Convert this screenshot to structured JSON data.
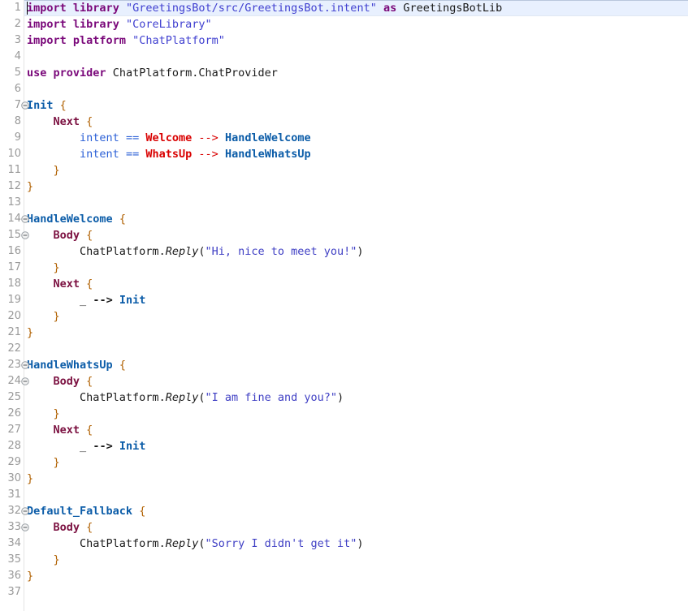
{
  "editor": {
    "name": "code-editor",
    "language": "intent-dsl",
    "total_lines": 37,
    "current_line": 1,
    "caret_line": 1,
    "caret_column": 1,
    "colors": {
      "background": "#ffffff",
      "current_line_highlight": "#e8f0fe",
      "gutter_text": "#999999",
      "keyword": "#7a087a",
      "block_keyword": "#7b1040",
      "state_name": "#0b5ca8",
      "string": "#3f3fc4",
      "constant": "#d90000",
      "brace": "#b06000",
      "operator": "#2a5fd6",
      "default_text": "#1a1a1a"
    }
  },
  "gutter": {
    "fold_marker_icon": "fold-collapse-icon",
    "fold_lines": [
      7,
      14,
      15,
      23,
      24,
      32,
      33
    ],
    "line_numbers": [
      1,
      2,
      3,
      4,
      5,
      6,
      7,
      8,
      9,
      10,
      11,
      12,
      13,
      14,
      15,
      16,
      17,
      18,
      19,
      20,
      21,
      22,
      23,
      24,
      25,
      26,
      27,
      28,
      29,
      30,
      31,
      32,
      33,
      34,
      35,
      36,
      37
    ]
  },
  "code": {
    "lines": [
      {
        "n": 1,
        "fold": false,
        "tokens": [
          {
            "c": "t-kw",
            "t": "import"
          },
          {
            "c": "t-punc",
            "t": " "
          },
          {
            "c": "t-kw",
            "t": "library"
          },
          {
            "c": "t-punc",
            "t": " "
          },
          {
            "c": "t-path",
            "t": "\"GreetingsBot/src/GreetingsBot.intent\""
          },
          {
            "c": "t-punc",
            "t": " "
          },
          {
            "c": "t-kw",
            "t": "as"
          },
          {
            "c": "t-punc",
            "t": " "
          },
          {
            "c": "t-ident",
            "t": "GreetingsBotLib"
          }
        ]
      },
      {
        "n": 2,
        "fold": false,
        "tokens": [
          {
            "c": "t-kw",
            "t": "import"
          },
          {
            "c": "t-punc",
            "t": " "
          },
          {
            "c": "t-kw",
            "t": "library"
          },
          {
            "c": "t-punc",
            "t": " "
          },
          {
            "c": "t-path",
            "t": "\"CoreLibrary\""
          }
        ]
      },
      {
        "n": 3,
        "fold": false,
        "tokens": [
          {
            "c": "t-kw",
            "t": "import"
          },
          {
            "c": "t-punc",
            "t": " "
          },
          {
            "c": "t-kw",
            "t": "platform"
          },
          {
            "c": "t-punc",
            "t": " "
          },
          {
            "c": "t-path",
            "t": "\"ChatPlatform\""
          }
        ]
      },
      {
        "n": 4,
        "fold": false,
        "tokens": []
      },
      {
        "n": 5,
        "fold": false,
        "tokens": [
          {
            "c": "t-kw",
            "t": "use"
          },
          {
            "c": "t-punc",
            "t": " "
          },
          {
            "c": "t-kw",
            "t": "provider"
          },
          {
            "c": "t-punc",
            "t": " "
          },
          {
            "c": "t-ident",
            "t": "ChatPlatform.ChatProvider"
          }
        ]
      },
      {
        "n": 6,
        "fold": false,
        "tokens": []
      },
      {
        "n": 7,
        "fold": true,
        "tokens": [
          {
            "c": "t-state",
            "t": "Init"
          },
          {
            "c": "t-punc",
            "t": " "
          },
          {
            "c": "t-brace",
            "t": "{"
          }
        ]
      },
      {
        "n": 8,
        "fold": false,
        "tokens": [
          {
            "c": "t-punc",
            "t": "    "
          },
          {
            "c": "t-block",
            "t": "Next"
          },
          {
            "c": "t-punc",
            "t": " "
          },
          {
            "c": "t-brace",
            "t": "{"
          }
        ]
      },
      {
        "n": 9,
        "fold": false,
        "tokens": [
          {
            "c": "t-punc",
            "t": "        "
          },
          {
            "c": "t-intent",
            "t": "intent"
          },
          {
            "c": "t-punc",
            "t": " "
          },
          {
            "c": "t-op",
            "t": "=="
          },
          {
            "c": "t-punc",
            "t": " "
          },
          {
            "c": "t-const",
            "t": "Welcome"
          },
          {
            "c": "t-punc",
            "t": " "
          },
          {
            "c": "t-arrow-r",
            "t": "-->"
          },
          {
            "c": "t-punc",
            "t": " "
          },
          {
            "c": "t-state",
            "t": "HandleWelcome"
          }
        ]
      },
      {
        "n": 10,
        "fold": false,
        "tokens": [
          {
            "c": "t-punc",
            "t": "        "
          },
          {
            "c": "t-intent",
            "t": "intent"
          },
          {
            "c": "t-punc",
            "t": " "
          },
          {
            "c": "t-op",
            "t": "=="
          },
          {
            "c": "t-punc",
            "t": " "
          },
          {
            "c": "t-const",
            "t": "WhatsUp"
          },
          {
            "c": "t-punc",
            "t": " "
          },
          {
            "c": "t-arrow-r",
            "t": "-->"
          },
          {
            "c": "t-punc",
            "t": " "
          },
          {
            "c": "t-state",
            "t": "HandleWhatsUp"
          }
        ]
      },
      {
        "n": 11,
        "fold": false,
        "tokens": [
          {
            "c": "t-punc",
            "t": "    "
          },
          {
            "c": "t-brace",
            "t": "}"
          }
        ]
      },
      {
        "n": 12,
        "fold": false,
        "tokens": [
          {
            "c": "t-brace",
            "t": "}"
          }
        ]
      },
      {
        "n": 13,
        "fold": false,
        "tokens": []
      },
      {
        "n": 14,
        "fold": true,
        "tokens": [
          {
            "c": "t-state",
            "t": "HandleWelcome"
          },
          {
            "c": "t-punc",
            "t": " "
          },
          {
            "c": "t-brace",
            "t": "{"
          }
        ]
      },
      {
        "n": 15,
        "fold": true,
        "tokens": [
          {
            "c": "t-punc",
            "t": "    "
          },
          {
            "c": "t-block",
            "t": "Body"
          },
          {
            "c": "t-punc",
            "t": " "
          },
          {
            "c": "t-brace",
            "t": "{"
          }
        ]
      },
      {
        "n": 16,
        "fold": false,
        "tokens": [
          {
            "c": "t-punc",
            "t": "        "
          },
          {
            "c": "t-ident",
            "t": "ChatPlatform."
          },
          {
            "c": "t-method",
            "t": "Reply"
          },
          {
            "c": "t-punc",
            "t": "("
          },
          {
            "c": "t-str",
            "t": "\"Hi, nice to meet you!\""
          },
          {
            "c": "t-punc",
            "t": ")"
          }
        ]
      },
      {
        "n": 17,
        "fold": false,
        "tokens": [
          {
            "c": "t-punc",
            "t": "    "
          },
          {
            "c": "t-brace",
            "t": "}"
          }
        ]
      },
      {
        "n": 18,
        "fold": false,
        "tokens": [
          {
            "c": "t-punc",
            "t": "    "
          },
          {
            "c": "t-block",
            "t": "Next"
          },
          {
            "c": "t-punc",
            "t": " "
          },
          {
            "c": "t-brace",
            "t": "{"
          }
        ]
      },
      {
        "n": 19,
        "fold": false,
        "tokens": [
          {
            "c": "t-punc",
            "t": "        "
          },
          {
            "c": "t-under",
            "t": "_"
          },
          {
            "c": "t-punc",
            "t": " "
          },
          {
            "c": "t-arrow-d",
            "t": "-->"
          },
          {
            "c": "t-punc",
            "t": " "
          },
          {
            "c": "t-state",
            "t": "Init"
          }
        ]
      },
      {
        "n": 20,
        "fold": false,
        "tokens": [
          {
            "c": "t-punc",
            "t": "    "
          },
          {
            "c": "t-brace",
            "t": "}"
          }
        ]
      },
      {
        "n": 21,
        "fold": false,
        "tokens": [
          {
            "c": "t-brace",
            "t": "}"
          }
        ]
      },
      {
        "n": 22,
        "fold": false,
        "tokens": []
      },
      {
        "n": 23,
        "fold": true,
        "tokens": [
          {
            "c": "t-state",
            "t": "HandleWhatsUp"
          },
          {
            "c": "t-punc",
            "t": " "
          },
          {
            "c": "t-brace",
            "t": "{"
          }
        ]
      },
      {
        "n": 24,
        "fold": true,
        "tokens": [
          {
            "c": "t-punc",
            "t": "    "
          },
          {
            "c": "t-block",
            "t": "Body"
          },
          {
            "c": "t-punc",
            "t": " "
          },
          {
            "c": "t-brace",
            "t": "{"
          }
        ]
      },
      {
        "n": 25,
        "fold": false,
        "tokens": [
          {
            "c": "t-punc",
            "t": "        "
          },
          {
            "c": "t-ident",
            "t": "ChatPlatform."
          },
          {
            "c": "t-method",
            "t": "Reply"
          },
          {
            "c": "t-punc",
            "t": "("
          },
          {
            "c": "t-str",
            "t": "\"I am fine and you?\""
          },
          {
            "c": "t-punc",
            "t": ")"
          }
        ]
      },
      {
        "n": 26,
        "fold": false,
        "tokens": [
          {
            "c": "t-punc",
            "t": "    "
          },
          {
            "c": "t-brace",
            "t": "}"
          }
        ]
      },
      {
        "n": 27,
        "fold": false,
        "tokens": [
          {
            "c": "t-punc",
            "t": "    "
          },
          {
            "c": "t-block",
            "t": "Next"
          },
          {
            "c": "t-punc",
            "t": " "
          },
          {
            "c": "t-brace",
            "t": "{"
          }
        ]
      },
      {
        "n": 28,
        "fold": false,
        "tokens": [
          {
            "c": "t-punc",
            "t": "        "
          },
          {
            "c": "t-under",
            "t": "_"
          },
          {
            "c": "t-punc",
            "t": " "
          },
          {
            "c": "t-arrow-d",
            "t": "-->"
          },
          {
            "c": "t-punc",
            "t": " "
          },
          {
            "c": "t-state",
            "t": "Init"
          }
        ]
      },
      {
        "n": 29,
        "fold": false,
        "tokens": [
          {
            "c": "t-punc",
            "t": "    "
          },
          {
            "c": "t-brace",
            "t": "}"
          }
        ]
      },
      {
        "n": 30,
        "fold": false,
        "tokens": [
          {
            "c": "t-brace",
            "t": "}"
          }
        ]
      },
      {
        "n": 31,
        "fold": false,
        "tokens": []
      },
      {
        "n": 32,
        "fold": true,
        "tokens": [
          {
            "c": "t-state",
            "t": "Default_Fallback"
          },
          {
            "c": "t-punc",
            "t": " "
          },
          {
            "c": "t-brace",
            "t": "{"
          }
        ]
      },
      {
        "n": 33,
        "fold": true,
        "tokens": [
          {
            "c": "t-punc",
            "t": "    "
          },
          {
            "c": "t-block",
            "t": "Body"
          },
          {
            "c": "t-punc",
            "t": " "
          },
          {
            "c": "t-brace",
            "t": "{"
          }
        ]
      },
      {
        "n": 34,
        "fold": false,
        "tokens": [
          {
            "c": "t-punc",
            "t": "        "
          },
          {
            "c": "t-ident",
            "t": "ChatPlatform."
          },
          {
            "c": "t-method",
            "t": "Reply"
          },
          {
            "c": "t-punc",
            "t": "("
          },
          {
            "c": "t-str",
            "t": "\"Sorry I didn't get it\""
          },
          {
            "c": "t-punc",
            "t": ")"
          }
        ]
      },
      {
        "n": 35,
        "fold": false,
        "tokens": [
          {
            "c": "t-punc",
            "t": "    "
          },
          {
            "c": "t-brace",
            "t": "}"
          }
        ]
      },
      {
        "n": 36,
        "fold": false,
        "tokens": [
          {
            "c": "t-brace",
            "t": "}"
          }
        ]
      },
      {
        "n": 37,
        "fold": false,
        "tokens": []
      }
    ]
  }
}
